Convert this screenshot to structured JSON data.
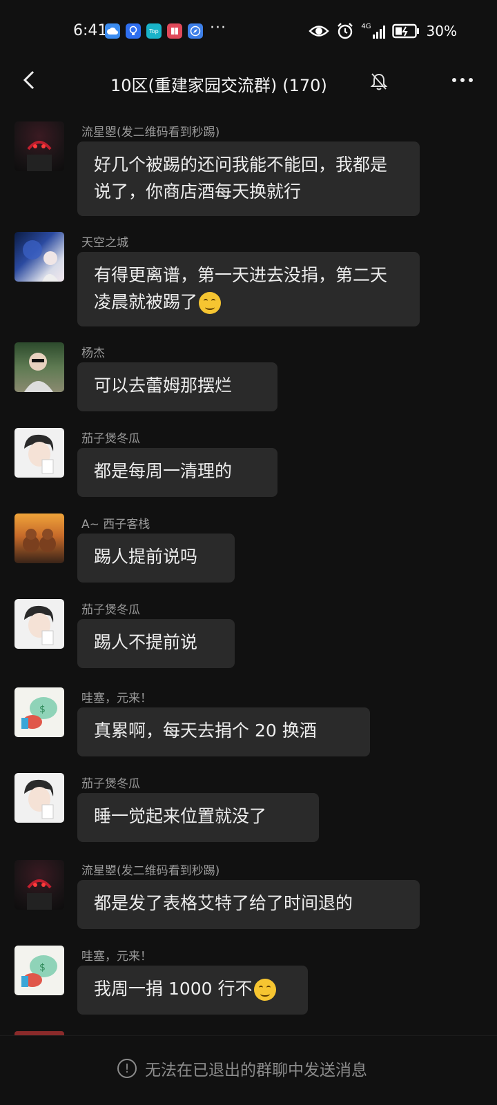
{
  "status_bar": {
    "time": "6:41",
    "more": "···",
    "network": "4G",
    "battery": "30%"
  },
  "header": {
    "title": "10区(重建家园交流群)",
    "member_count": "(170)"
  },
  "messages": [
    {
      "sender": "流星曌(发二维码看到秒踢)",
      "text": "好几个被踢的还问我能不能回，我都是说了，你商店酒每天换就行",
      "emoji": false
    },
    {
      "sender": "天空之城",
      "text": "有得更离谱，第一天进去没捐，第二天凌晨就被踢了",
      "emoji": true
    },
    {
      "sender": "杨杰",
      "text": "可以去蕾姆那摆烂",
      "emoji": false
    },
    {
      "sender": "茄子煲冬瓜",
      "text": "都是每周一清理的",
      "emoji": false
    },
    {
      "sender": "A~ 西子客栈",
      "text": "踢人提前说吗",
      "emoji": false
    },
    {
      "sender": "茄子煲冬瓜",
      "text": "踢人不提前说",
      "emoji": false
    },
    {
      "sender": "哇塞，元来！",
      "text": "真累啊，每天去捐个 20 换酒",
      "emoji": false
    },
    {
      "sender": "茄子煲冬瓜",
      "text": "睡一觉起来位置就没了",
      "emoji": false
    },
    {
      "sender": "流星曌(发二维码看到秒踢)",
      "text": "都是发了表格艾特了给了时间退的",
      "emoji": false
    },
    {
      "sender": "哇塞，元来！",
      "text": "我周一捐 1000 行不",
      "emoji": true
    }
  ],
  "bottom": {
    "notice": "无法在已退出的群聊中发送消息"
  }
}
